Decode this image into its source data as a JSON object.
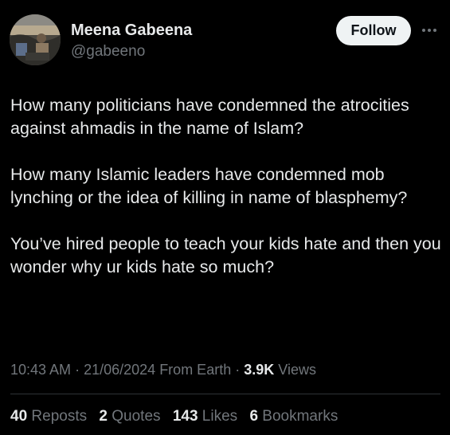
{
  "author": {
    "display_name": "Meena Gabeena",
    "handle": "@gabeeno",
    "avatar_icon": "profile-photo"
  },
  "actions": {
    "follow_label": "Follow",
    "more_icon": "more-options-icon"
  },
  "tweet": {
    "paragraphs": [
      "How many politicians have condemned the atrocities against ahmadis in the name of Islam?",
      "How many Islamic leaders have condemned mob lynching or the idea of killing in name of blasphemy?",
      "You’ve hired people to teach your kids hate and then you wonder why ur kids hate so much?"
    ],
    "time": "10:43 AM",
    "date": "21/06/2024",
    "source": "From Earth",
    "views_count": "3.9K",
    "views_label": "Views"
  },
  "stats": {
    "reposts": {
      "count": "40",
      "label": "Reposts"
    },
    "quotes": {
      "count": "2",
      "label": "Quotes"
    },
    "likes": {
      "count": "143",
      "label": "Likes"
    },
    "bookmarks": {
      "count": "6",
      "label": "Bookmarks"
    }
  },
  "colors": {
    "background": "#000000",
    "text_primary": "#e7e9ea",
    "text_secondary": "#71767b",
    "follow_button_bg": "#eff3f4",
    "divider": "#2f3336"
  }
}
